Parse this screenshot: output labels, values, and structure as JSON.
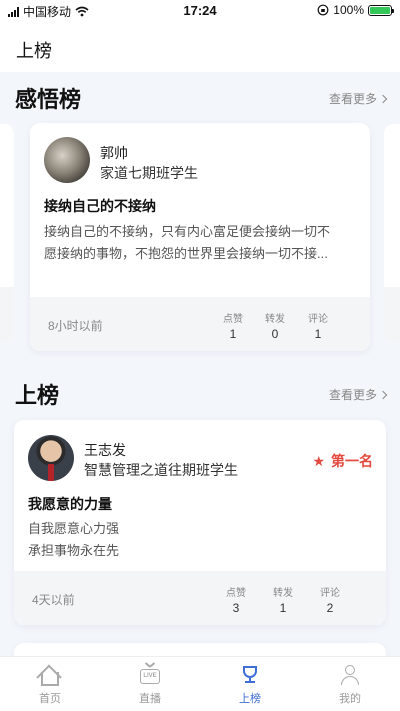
{
  "status_bar": {
    "carrier": "中国移动",
    "time": "17:24",
    "battery": "100%"
  },
  "header": {
    "title": "上榜"
  },
  "sections": {
    "insight": {
      "title": "感悟榜",
      "more": "查看更多"
    },
    "ranking": {
      "title": "上榜",
      "more": "查看更多"
    }
  },
  "insight_card": {
    "user_name": "郭帅",
    "user_role": "家道七期班学生",
    "title": "接纳自己的不接纳",
    "body_line1": "接纳自己的不接纳，只有内心富足便会接纳一切不",
    "body_line2": "愿接纳的事物，不抱怨的世界里会接纳一切不接...",
    "time": "8小时以前",
    "likes_label": "点赞",
    "likes": "1",
    "shares_label": "转发",
    "shares": "0",
    "comments_label": "评论",
    "comments": "1"
  },
  "ranking_card": {
    "user_name": "王志发",
    "user_role": "智慧管理之道往期班学生",
    "rank": "第一名",
    "title": "我愿意的力量",
    "body_line1": "自我愿意心力强",
    "body_line2": "承担事物永在先",
    "time": "4天以前",
    "likes_label": "点赞",
    "likes": "3",
    "shares_label": "转发",
    "shares": "1",
    "comments_label": "评论",
    "comments": "2"
  },
  "tabbar": {
    "home": "首页",
    "live": "直播",
    "rank": "上榜",
    "mine": "我的",
    "live_badge": "LIVE"
  },
  "colors": {
    "accent": "#3d6fd6",
    "rank_red": "#e3493f",
    "background": "#f3f6fb"
  }
}
